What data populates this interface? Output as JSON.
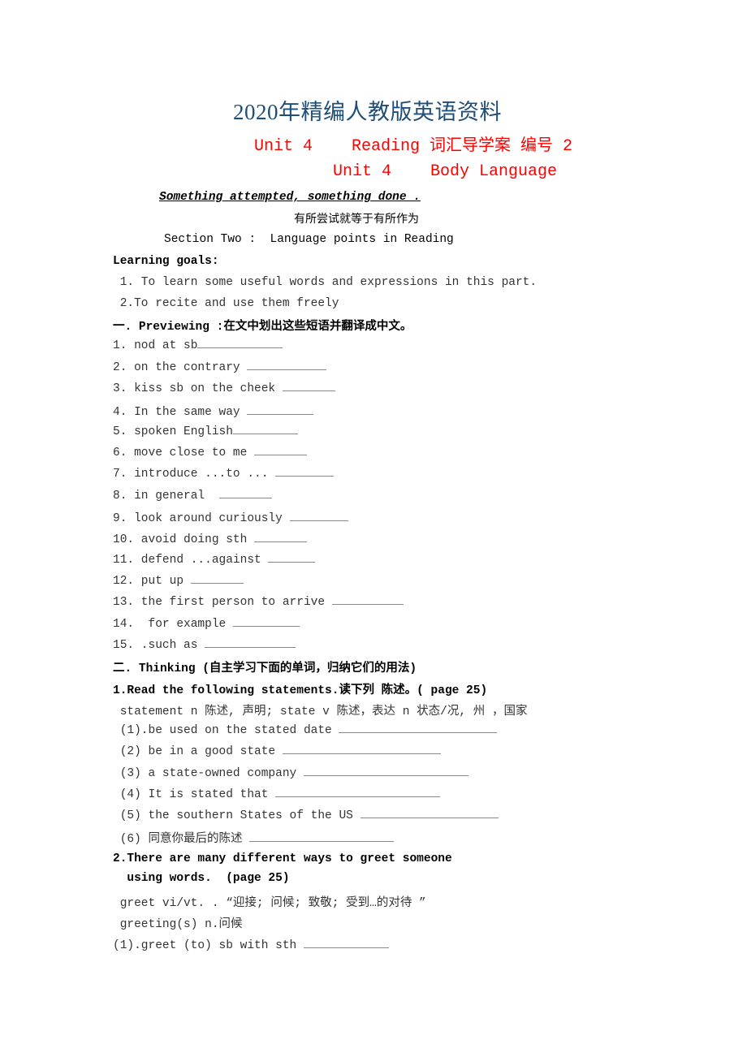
{
  "header": {
    "title": "2020年精编人教版英语资料",
    "subtitle1": "Unit 4    Reading 词汇导学案 编号 2",
    "subtitle2": "Unit 4    Body Language",
    "motto_en": "Something attempted, something done .",
    "motto_cn": "有所尝试就等于有所作为",
    "section": "Section Two :  Language points in Reading"
  },
  "goals": {
    "heading": "Learning goals:",
    "items": [
      " 1. To learn some useful words and expressions in this part.",
      " 2.To recite and use them freely"
    ]
  },
  "previewing": {
    "heading": "一. Previewing :在文中划出这些短语并翻译成中文。",
    "items": [
      {
        "text": "1. nod at sb",
        "blank": 105
      },
      {
        "text": "2. on the contrary ",
        "blank": 98
      },
      {
        "text": "3. kiss sb on the cheek ",
        "blank": 65
      },
      {
        "text": "4. In the same way ",
        "blank": 82
      },
      {
        "text": "5. spoken English",
        "blank": 80
      },
      {
        "text": "6. move close to me ",
        "blank": 65
      },
      {
        "text": "7. introduce ...to ... ",
        "blank": 72
      },
      {
        "text": "8. in general  ",
        "blank": 65
      },
      {
        "text": "9. look around curiously ",
        "blank": 72
      },
      {
        "text": "10. avoid doing sth ",
        "blank": 65
      },
      {
        "text": "11. defend ...against ",
        "blank": 58
      },
      {
        "text": "12. put up ",
        "blank": 65
      },
      {
        "text": "13. the first person to arrive ",
        "blank": 88
      },
      {
        "text": "14.  for example ",
        "blank": 82
      },
      {
        "text": "15. .such as ",
        "blank": 112
      }
    ]
  },
  "thinking": {
    "heading": "二. Thinking (自主学习下面的单词，归纳它们的用法)",
    "q1": {
      "heading": "1.Read the following statements.读下列 陈述。( page 25)",
      "note": " statement n 陈述, 声明; state v 陈述，表达 n 状态/况, 州 ，国家",
      "items": [
        {
          "text": " (1).be used on the stated date ",
          "blank": 195
        },
        {
          "text": " (2) be in a good state ",
          "blank": 195
        },
        {
          "text": " (3) a state-owned company ",
          "blank": 203
        },
        {
          "text": " (4) It is stated that ",
          "blank": 203
        },
        {
          "text": " (5) the southern States of the US ",
          "blank": 170
        },
        {
          "text": " (6) 同意你最后的陈述 ",
          "blank": 178
        }
      ]
    },
    "q2": {
      "heading": "2.There are many different ways to greet someone",
      "heading_cont": "  using words.  (page 25)",
      "notes": [
        " greet vi/vt. . “迎接; 问候; 致敬; 受到…的对待 ”",
        " greeting(s) n.问候"
      ],
      "items": [
        {
          "text": "(1).greet (to) sb with sth ",
          "blank": 105
        }
      ]
    }
  }
}
